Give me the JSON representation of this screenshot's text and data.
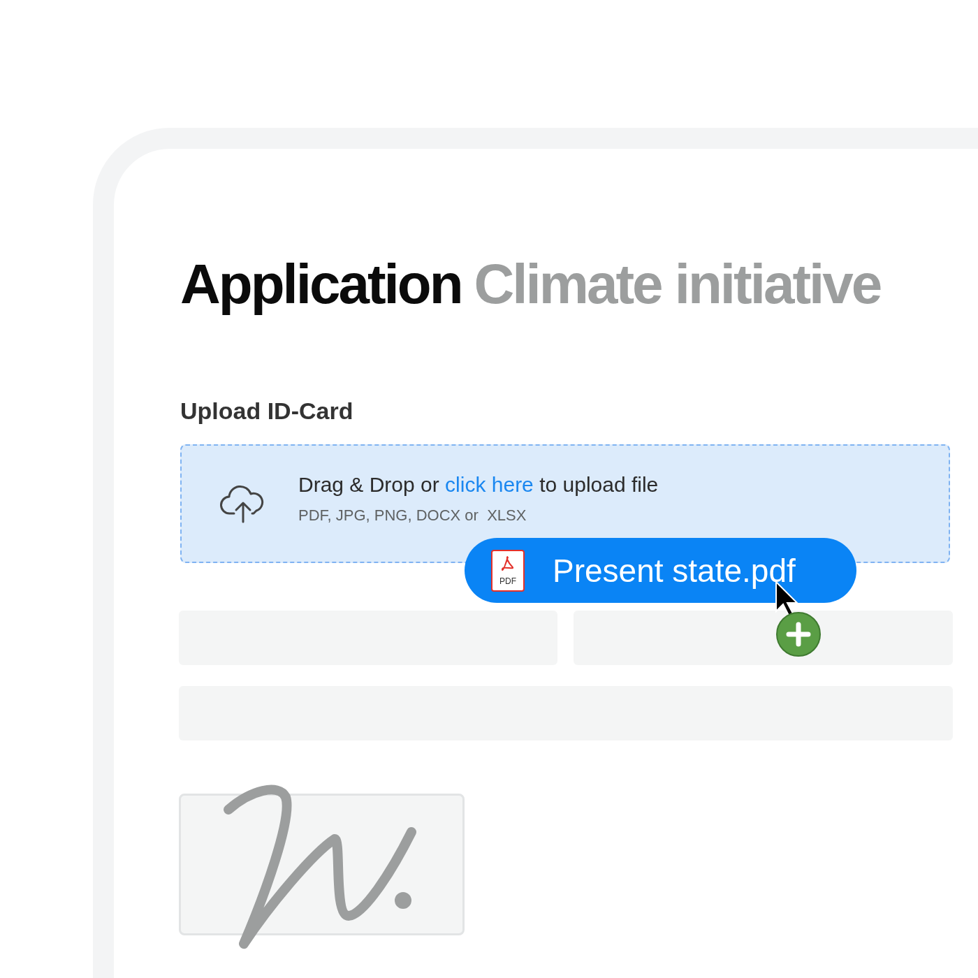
{
  "title": {
    "main": "Application",
    "sub": "Climate initiative"
  },
  "upload": {
    "label": "Upload ID-Card",
    "prompt_before": "Drag & Drop or",
    "link": "click here",
    "prompt_after": "to upload file",
    "formats": "PDF, JPG, PNG, DOCX or  XLSX"
  },
  "dragged_file": {
    "name": "Present state.pdf",
    "icon_label": "PDF"
  }
}
